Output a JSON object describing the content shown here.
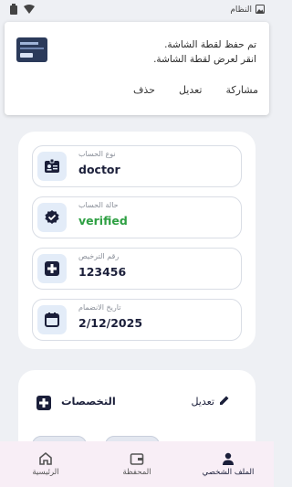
{
  "status_bar": {
    "app_label": "النظام"
  },
  "screenshot_toast": {
    "message_line1": "تم حفظ لقطة الشاشة.",
    "message_line2": "انقر لعرض لقطة الشاشة.",
    "actions": {
      "share": "مشاركة",
      "edit": "تعديل",
      "delete": "حذف"
    }
  },
  "account": {
    "type_label": "نوع الحساب",
    "type_value": "doctor",
    "status_label": "حالة الحساب",
    "status_value": "verified",
    "status_color": "#2ea043",
    "license_label": "رقم الترخيص",
    "license_value": "123456",
    "joined_label": "تاريخ الانضمام",
    "joined_value": "2/12/2025"
  },
  "specialties": {
    "title": "التخصصات",
    "edit_label": "تعديل"
  },
  "bottom_nav": {
    "profile": "الملف الشخصي",
    "wallet": "المحفظة",
    "home": "الرئيسية"
  },
  "colors": {
    "accent": "#1b1f3a",
    "icon_bg": "#e3ecf8",
    "nav_bg": "#f8eef6"
  }
}
